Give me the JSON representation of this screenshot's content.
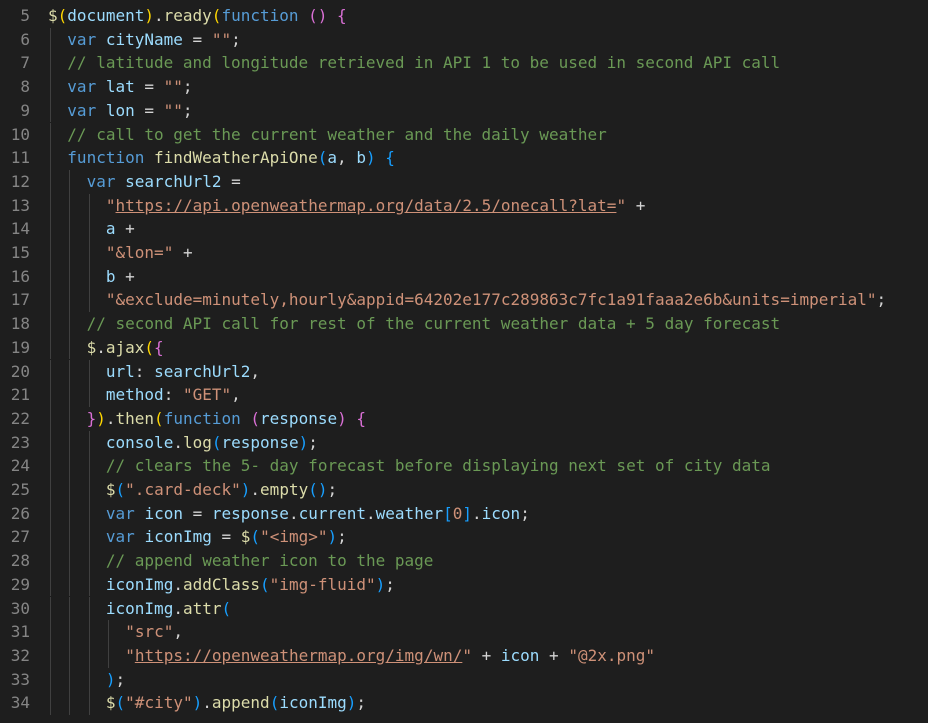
{
  "editor": {
    "language": "javascript",
    "colors": {
      "background": "#1e1e1e",
      "line_number": "#858585",
      "keyword": "#569cd6",
      "function": "#dcdcaa",
      "variable": "#9cdcfe",
      "string": "#ce9178",
      "comment": "#6a9955",
      "bracket_level_1": "#ffd700",
      "bracket_level_2": "#da70d6",
      "bracket_level_3": "#179fff"
    },
    "lines": [
      {
        "number": "5",
        "indent": 0,
        "tokens": [
          [
            "fn",
            "$"
          ],
          [
            "p1",
            "("
          ],
          [
            "var",
            "document"
          ],
          [
            "p1",
            ")"
          ],
          [
            "pun",
            "."
          ],
          [
            "fn",
            "ready"
          ],
          [
            "p1",
            "("
          ],
          [
            "kw",
            "function"
          ],
          [
            "pun",
            " "
          ],
          [
            "p2",
            "()"
          ],
          [
            "pun",
            " "
          ],
          [
            "p2",
            "{"
          ]
        ]
      },
      {
        "number": "6",
        "indent": 1,
        "tokens": [
          [
            "kw",
            "var"
          ],
          [
            "pun",
            " "
          ],
          [
            "var",
            "cityName"
          ],
          [
            "pun",
            " = "
          ],
          [
            "str",
            "\"\""
          ],
          [
            "pun",
            ";"
          ]
        ]
      },
      {
        "number": "7",
        "indent": 1,
        "tokens": [
          [
            "cm",
            "// latitude and longitude retrieved in API 1 to be used in second API call"
          ]
        ]
      },
      {
        "number": "8",
        "indent": 1,
        "tokens": [
          [
            "kw",
            "var"
          ],
          [
            "pun",
            " "
          ],
          [
            "var",
            "lat"
          ],
          [
            "pun",
            " = "
          ],
          [
            "str",
            "\"\""
          ],
          [
            "pun",
            ";"
          ]
        ]
      },
      {
        "number": "9",
        "indent": 1,
        "tokens": [
          [
            "kw",
            "var"
          ],
          [
            "pun",
            " "
          ],
          [
            "var",
            "lon"
          ],
          [
            "pun",
            " = "
          ],
          [
            "str",
            "\"\""
          ],
          [
            "pun",
            ";"
          ]
        ]
      },
      {
        "number": "10",
        "indent": 1,
        "tokens": [
          [
            "cm",
            "// call to get the current weather and the daily weather"
          ]
        ]
      },
      {
        "number": "11",
        "indent": 1,
        "tokens": [
          [
            "kw",
            "function"
          ],
          [
            "pun",
            " "
          ],
          [
            "fn",
            "findWeatherApiOne"
          ],
          [
            "p3",
            "("
          ],
          [
            "var",
            "a"
          ],
          [
            "pun",
            ", "
          ],
          [
            "var",
            "b"
          ],
          [
            "p3",
            ")"
          ],
          [
            "pun",
            " "
          ],
          [
            "p3",
            "{"
          ]
        ]
      },
      {
        "number": "12",
        "indent": 2,
        "tokens": [
          [
            "kw",
            "var"
          ],
          [
            "pun",
            " "
          ],
          [
            "var",
            "searchUrl2"
          ],
          [
            "pun",
            " ="
          ]
        ]
      },
      {
        "number": "13",
        "indent": 3,
        "tokens": [
          [
            "str",
            "\""
          ],
          [
            "str url",
            "https://api.openweathermap.org/data/2.5/onecall?lat="
          ],
          [
            "str",
            "\""
          ],
          [
            "pun",
            " +"
          ]
        ]
      },
      {
        "number": "14",
        "indent": 3,
        "tokens": [
          [
            "var",
            "a"
          ],
          [
            "pun",
            " +"
          ]
        ]
      },
      {
        "number": "15",
        "indent": 3,
        "tokens": [
          [
            "str",
            "\"&lon=\""
          ],
          [
            "pun",
            " +"
          ]
        ]
      },
      {
        "number": "16",
        "indent": 3,
        "tokens": [
          [
            "var",
            "b"
          ],
          [
            "pun",
            " +"
          ]
        ]
      },
      {
        "number": "17",
        "indent": 3,
        "tokens": [
          [
            "str",
            "\"&exclude=minutely,hourly&appid=64202e177c289863c7fc1a91faaa2e6b&units=imperial\""
          ],
          [
            "pun",
            ";"
          ]
        ]
      },
      {
        "number": "18",
        "indent": 2,
        "tokens": [
          [
            "cm",
            "// second API call for rest of the current weather data + 5 day forecast"
          ]
        ]
      },
      {
        "number": "19",
        "indent": 2,
        "tokens": [
          [
            "fn",
            "$"
          ],
          [
            "pun",
            "."
          ],
          [
            "fn",
            "ajax"
          ],
          [
            "p1",
            "("
          ],
          [
            "p2",
            "{"
          ]
        ]
      },
      {
        "number": "20",
        "indent": 3,
        "tokens": [
          [
            "var",
            "url"
          ],
          [
            "pun",
            ": "
          ],
          [
            "var",
            "searchUrl2"
          ],
          [
            "pun",
            ","
          ]
        ]
      },
      {
        "number": "21",
        "indent": 3,
        "tokens": [
          [
            "var",
            "method"
          ],
          [
            "pun",
            ": "
          ],
          [
            "str",
            "\"GET\""
          ],
          [
            "pun",
            ","
          ]
        ]
      },
      {
        "number": "22",
        "indent": 2,
        "tokens": [
          [
            "p2",
            "}"
          ],
          [
            "p1",
            ")"
          ],
          [
            "pun",
            "."
          ],
          [
            "fn",
            "then"
          ],
          [
            "p1",
            "("
          ],
          [
            "kw",
            "function"
          ],
          [
            "pun",
            " "
          ],
          [
            "p2",
            "("
          ],
          [
            "var",
            "response"
          ],
          [
            "p2",
            ")"
          ],
          [
            "pun",
            " "
          ],
          [
            "p2",
            "{"
          ]
        ]
      },
      {
        "number": "23",
        "indent": 3,
        "tokens": [
          [
            "var",
            "console"
          ],
          [
            "pun",
            "."
          ],
          [
            "fn",
            "log"
          ],
          [
            "p3",
            "("
          ],
          [
            "var",
            "response"
          ],
          [
            "p3",
            ")"
          ],
          [
            "pun",
            ";"
          ]
        ]
      },
      {
        "number": "24",
        "indent": 3,
        "tokens": [
          [
            "cm",
            "// clears the 5- day forecast before displaying next set of city data"
          ]
        ]
      },
      {
        "number": "25",
        "indent": 3,
        "tokens": [
          [
            "fn",
            "$"
          ],
          [
            "p3",
            "("
          ],
          [
            "str",
            "\".card-deck\""
          ],
          [
            "p3",
            ")"
          ],
          [
            "pun",
            "."
          ],
          [
            "fn",
            "empty"
          ],
          [
            "p3",
            "()"
          ],
          [
            "pun",
            ";"
          ]
        ]
      },
      {
        "number": "26",
        "indent": 3,
        "tokens": [
          [
            "kw",
            "var"
          ],
          [
            "pun",
            " "
          ],
          [
            "var",
            "icon"
          ],
          [
            "pun",
            " = "
          ],
          [
            "var",
            "response"
          ],
          [
            "pun",
            "."
          ],
          [
            "var",
            "current"
          ],
          [
            "pun",
            "."
          ],
          [
            "var",
            "weather"
          ],
          [
            "p3",
            "["
          ],
          [
            "str",
            "0"
          ],
          [
            "p3",
            "]"
          ],
          [
            "pun",
            "."
          ],
          [
            "var",
            "icon"
          ],
          [
            "pun",
            ";"
          ]
        ]
      },
      {
        "number": "27",
        "indent": 3,
        "tokens": [
          [
            "kw",
            "var"
          ],
          [
            "pun",
            " "
          ],
          [
            "var",
            "iconImg"
          ],
          [
            "pun",
            " = "
          ],
          [
            "fn",
            "$"
          ],
          [
            "p3",
            "("
          ],
          [
            "str",
            "\"<img>\""
          ],
          [
            "p3",
            ")"
          ],
          [
            "pun",
            ";"
          ]
        ]
      },
      {
        "number": "28",
        "indent": 3,
        "tokens": [
          [
            "cm",
            "// append weather icon to the page"
          ]
        ]
      },
      {
        "number": "29",
        "indent": 3,
        "tokens": [
          [
            "var",
            "iconImg"
          ],
          [
            "pun",
            "."
          ],
          [
            "fn",
            "addClass"
          ],
          [
            "p3",
            "("
          ],
          [
            "str",
            "\"img-fluid\""
          ],
          [
            "p3",
            ")"
          ],
          [
            "pun",
            ";"
          ]
        ]
      },
      {
        "number": "30",
        "indent": 3,
        "tokens": [
          [
            "var",
            "iconImg"
          ],
          [
            "pun",
            "."
          ],
          [
            "fn",
            "attr"
          ],
          [
            "p3",
            "("
          ]
        ]
      },
      {
        "number": "31",
        "indent": 4,
        "tokens": [
          [
            "str",
            "\"src\""
          ],
          [
            "pun",
            ","
          ]
        ]
      },
      {
        "number": "32",
        "indent": 4,
        "tokens": [
          [
            "str",
            "\""
          ],
          [
            "str url",
            "https://openweathermap.org/img/wn/"
          ],
          [
            "str",
            "\""
          ],
          [
            "pun",
            " + "
          ],
          [
            "var",
            "icon"
          ],
          [
            "pun",
            " + "
          ],
          [
            "str",
            "\"@2x.png\""
          ]
        ]
      },
      {
        "number": "33",
        "indent": 3,
        "tokens": [
          [
            "p3",
            ")"
          ],
          [
            "pun",
            ";"
          ]
        ]
      },
      {
        "number": "34",
        "indent": 3,
        "tokens": [
          [
            "fn",
            "$"
          ],
          [
            "p3",
            "("
          ],
          [
            "str",
            "\"#city\""
          ],
          [
            "p3",
            ")"
          ],
          [
            "pun",
            "."
          ],
          [
            "fn",
            "append"
          ],
          [
            "p3",
            "("
          ],
          [
            "var",
            "iconImg"
          ],
          [
            "p3",
            ")"
          ],
          [
            "pun",
            ";"
          ]
        ]
      }
    ]
  }
}
